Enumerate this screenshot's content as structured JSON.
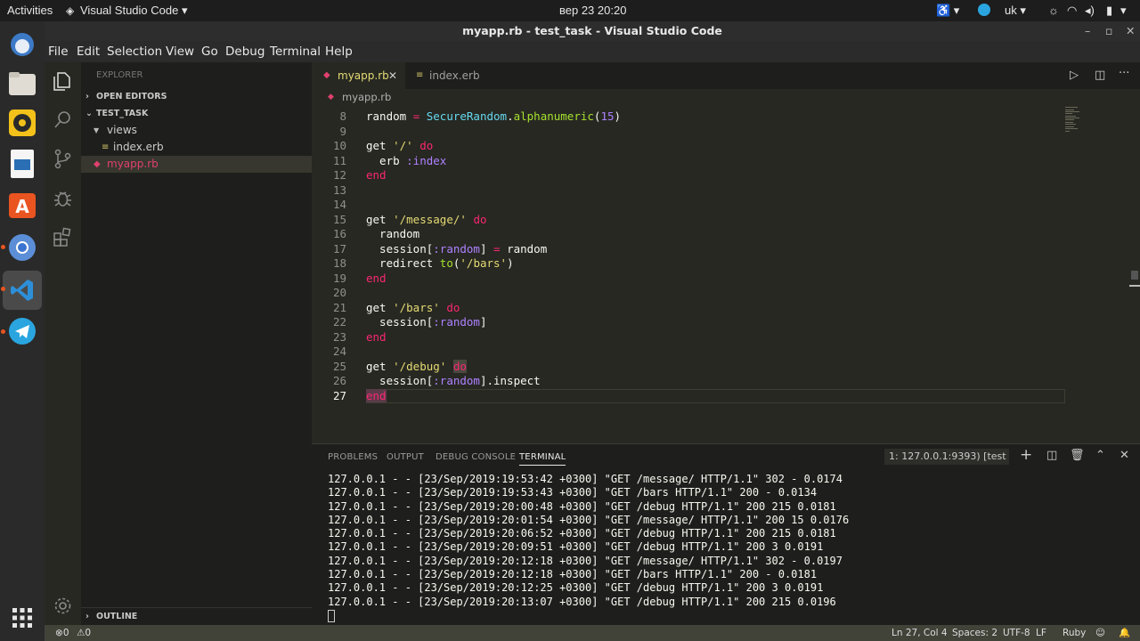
{
  "topbar": {
    "activities": "Activities",
    "app": "Visual Studio Code ▾",
    "clock": "вер 23  20:20",
    "lang": "uk ▾"
  },
  "window_title": "myapp.rb - test_task - Visual Studio Code",
  "menu": [
    "File",
    "Edit",
    "Selection",
    "View",
    "Go",
    "Debug",
    "Terminal",
    "Help"
  ],
  "sidebar": {
    "header": "EXPLORER",
    "open_editors": "OPEN EDITORS",
    "folder": "TEST_TASK",
    "views": "views",
    "index": "index.erb",
    "myapp": "myapp.rb",
    "outline": "OUTLINE"
  },
  "tabs": {
    "active": "myapp.rb",
    "second": "index.erb"
  },
  "breadcrumb": "myapp.rb",
  "code": [
    {
      "n": "8",
      "t": "random = SecureRandom.alphanumeric(15)"
    },
    {
      "n": "9",
      "t": ""
    },
    {
      "n": "10",
      "t": "get '/' do"
    },
    {
      "n": "11",
      "t": "  erb :index"
    },
    {
      "n": "12",
      "t": "end"
    },
    {
      "n": "13",
      "t": ""
    },
    {
      "n": "14",
      "t": ""
    },
    {
      "n": "15",
      "t": "get '/message/' do"
    },
    {
      "n": "16",
      "t": "  random"
    },
    {
      "n": "17",
      "t": "  session[:random] = random"
    },
    {
      "n": "18",
      "t": "  redirect to('/bars')"
    },
    {
      "n": "19",
      "t": "end"
    },
    {
      "n": "20",
      "t": ""
    },
    {
      "n": "21",
      "t": "get '/bars' do"
    },
    {
      "n": "22",
      "t": "  session[:random]"
    },
    {
      "n": "23",
      "t": "end"
    },
    {
      "n": "24",
      "t": ""
    },
    {
      "n": "25",
      "t": "get '/debug' do"
    },
    {
      "n": "26",
      "t": "  session[:random].inspect"
    },
    {
      "n": "27",
      "t": "end"
    }
  ],
  "panel": {
    "problems": "PROBLEMS",
    "output": "OUTPUT",
    "debug_console": "DEBUG CONSOLE",
    "terminal": "TERMINAL",
    "terminal_select": "1: 127.0.0.1:9393) [test ▾"
  },
  "terminal_lines": [
    "127.0.0.1 - - [23/Sep/2019:19:53:42 +0300] \"GET /message/ HTTP/1.1\" 302 - 0.0174",
    "127.0.0.1 - - [23/Sep/2019:19:53:43 +0300] \"GET /bars HTTP/1.1\" 200 - 0.0134",
    "127.0.0.1 - - [23/Sep/2019:20:00:48 +0300] \"GET /debug HTTP/1.1\" 200 215 0.0181",
    "127.0.0.1 - - [23/Sep/2019:20:01:54 +0300] \"GET /message/ HTTP/1.1\" 200 15 0.0176",
    "127.0.0.1 - - [23/Sep/2019:20:06:52 +0300] \"GET /debug HTTP/1.1\" 200 215 0.0181",
    "127.0.0.1 - - [23/Sep/2019:20:09:51 +0300] \"GET /debug HTTP/1.1\" 200 3 0.0191",
    "127.0.0.1 - - [23/Sep/2019:20:12:18 +0300] \"GET /message/ HTTP/1.1\" 302 - 0.0197",
    "127.0.0.1 - - [23/Sep/2019:20:12:18 +0300] \"GET /bars HTTP/1.1\" 200 - 0.0181",
    "127.0.0.1 - - [23/Sep/2019:20:12:25 +0300] \"GET /debug HTTP/1.1\" 200 3 0.0191",
    "127.0.0.1 - - [23/Sep/2019:20:13:07 +0300] \"GET /debug HTTP/1.1\" 200 215 0.0196"
  ],
  "status": {
    "errors": "0",
    "warnings": "0",
    "position": "Ln 27, Col 4",
    "spaces": "Spaces: 2",
    "encoding": "UTF-8",
    "eol": "LF",
    "language": "Ruby"
  }
}
